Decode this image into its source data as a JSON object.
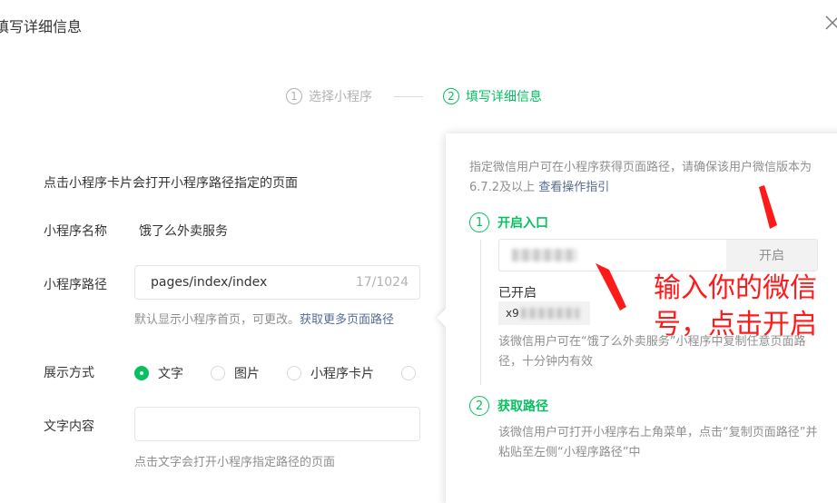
{
  "dialog": {
    "title": "填写详细信息"
  },
  "steps": [
    {
      "num": "1",
      "label": "选择小程序"
    },
    {
      "num": "2",
      "label": "填写详细信息"
    }
  ],
  "form": {
    "hint": "点击小程序卡片会打开小程序路径指定的页面",
    "name_label": "小程序名称",
    "name_value": "饿了么外卖服务",
    "path_label": "小程序路径",
    "path_value": "pages/index/index",
    "path_count": "17/1024",
    "path_hint": "默认显示小程序首页，可更改。",
    "path_link": "获取更多页面路径",
    "display_label": "展示方式",
    "display_options": [
      "文字",
      "图片",
      "小程序卡片"
    ],
    "text_label": "文字内容",
    "text_hint": "点击文字会打开小程序指定路径的页面"
  },
  "popover": {
    "desc": "指定微信用户可在小程序获得页面路径，请确保该用户微信版本为6.7.2及以上",
    "desc_link": "查看操作指引",
    "step1_num": "1",
    "step1_label": "开启入口",
    "open_button": "开启",
    "opened_label": "已开启",
    "opened_user_prefix": "x9",
    "step1_note": "该微信用户可在“饿了么外卖服务”小程序中复制任意页面路径，十分钟内有效",
    "step2_num": "2",
    "step2_label": "获取路径",
    "step2_note": "该微信用户可打开小程序右上角菜单，点击“复制页面路径”并粘贴至左侧“小程序路径”中"
  },
  "annotation": {
    "line1": "输入你的微信",
    "line2": "号，点击开启",
    "color": "#ff1a1a"
  },
  "colors": {
    "accent": "#07c160",
    "link": "#576b95"
  }
}
